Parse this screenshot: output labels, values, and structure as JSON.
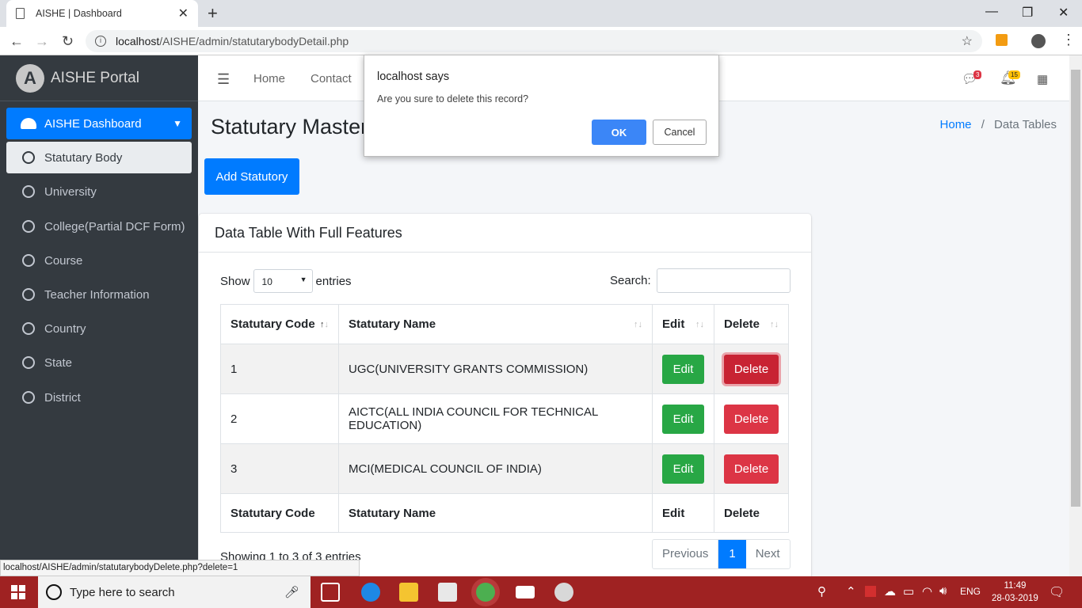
{
  "browser": {
    "tab_title": "AISHE | Dashboard",
    "url_host": "localhost",
    "url_path": "/AISHE/admin/statutarybodyDetail.php",
    "status_url": "localhost/AISHE/admin/statutarybodyDelete.php?delete=1"
  },
  "sidebar": {
    "brand": "AISHE Portal",
    "logo_letter": "A",
    "dashboard": "AISHE Dashboard",
    "items": [
      {
        "label": "Statutary Body"
      },
      {
        "label": "University"
      },
      {
        "label": "College(Partial DCF Form)"
      },
      {
        "label": "Course"
      },
      {
        "label": "Teacher Information"
      },
      {
        "label": "Country"
      },
      {
        "label": "State"
      },
      {
        "label": "District"
      }
    ]
  },
  "topnav": {
    "home": "Home",
    "contact": "Contact",
    "messages_count": "3",
    "notifications_count": "15"
  },
  "page": {
    "title": "Statutary Master",
    "breadcrumb_home": "Home",
    "breadcrumb_sep": "/",
    "breadcrumb_current": "Data Tables",
    "add_button": "Add Statutory"
  },
  "card": {
    "title": "Data Table With Full Features",
    "show": "Show",
    "entries_value": "10",
    "entries": "entries",
    "search_label": "Search:",
    "columns": [
      "Statutary Code",
      "Statutary Name",
      "Edit",
      "Delete"
    ],
    "rows": [
      {
        "code": "1",
        "name": "UGC(UNIVERSITY GRANTS COMMISSION)",
        "edit": "Edit",
        "delete": "Delete"
      },
      {
        "code": "2",
        "name": "AICTC(ALL INDIA COUNCIL FOR TECHNICAL EDUCATION)",
        "edit": "Edit",
        "delete": "Delete"
      },
      {
        "code": "3",
        "name": "MCI(MEDICAL COUNCIL OF INDIA)",
        "edit": "Edit",
        "delete": "Delete"
      }
    ],
    "info": "Showing 1 to 3 of 3 entries",
    "prev": "Previous",
    "page": "1",
    "next": "Next"
  },
  "dialog": {
    "title": "localhost says",
    "message": "Are you sure to delete this record?",
    "ok": "OK",
    "cancel": "Cancel"
  },
  "taskbar": {
    "search_placeholder": "Type here to search",
    "lang": "ENG",
    "time": "11:49",
    "date": "28-03-2019"
  },
  "colors": {
    "primary": "#007bff",
    "success": "#28a745",
    "danger": "#dc3545",
    "sidebar": "#343a40",
    "taskbar": "#9f2222"
  }
}
